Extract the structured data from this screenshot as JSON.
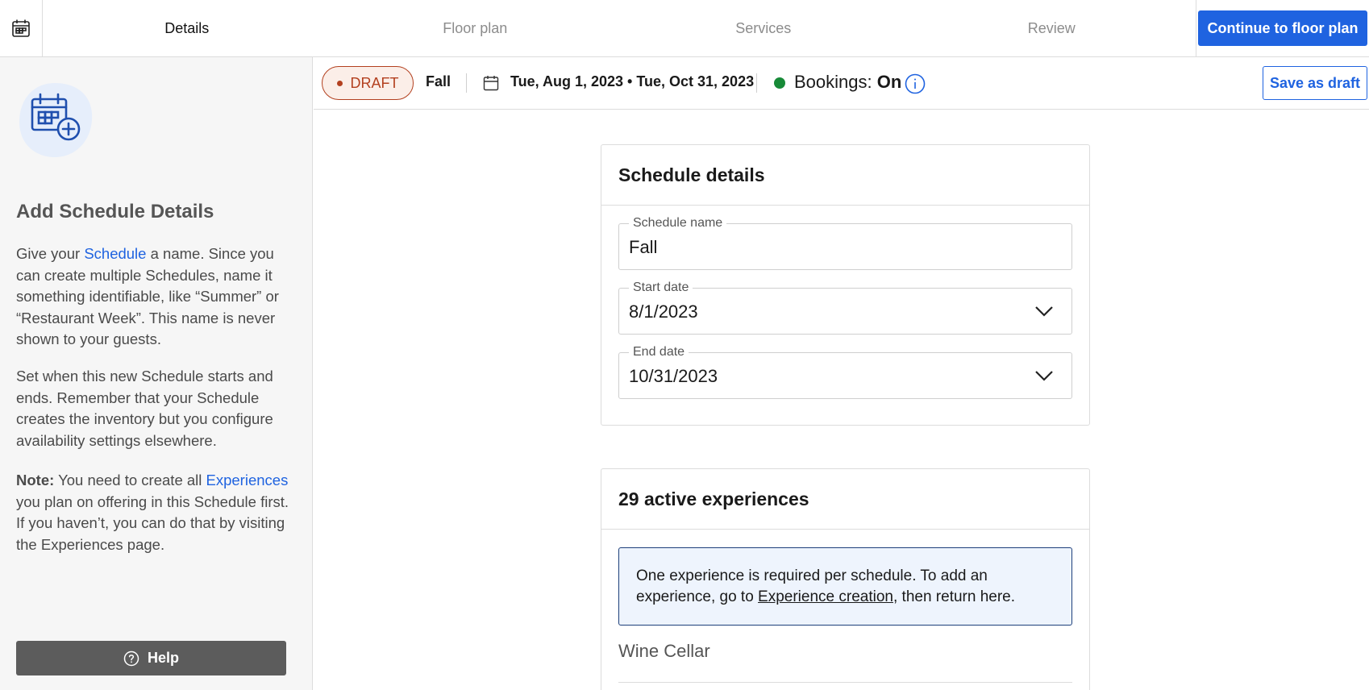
{
  "nav": {
    "steps": [
      {
        "label": "Details",
        "active": true
      },
      {
        "label": "Floor plan",
        "active": false
      },
      {
        "label": "Services",
        "active": false
      },
      {
        "label": "Review",
        "active": false
      }
    ],
    "continue_label": "Continue to floor plan"
  },
  "sidebar": {
    "title": "Add Schedule Details",
    "p1_pre": "Give your ",
    "p1_link": "Schedule",
    "p1_post": " a name. Since you can create multiple Schedules, name it something identifiable, like “Summer” or “Restaurant Week”. This name is never shown to your guests.",
    "p2": "Set when this new Schedule starts and ends. Remember that your Schedule creates the inventory but you configure availability settings elsewhere.",
    "p3_bold": "Note:",
    "p3_pre": " You need to create all ",
    "p3_link": "Experiences",
    "p3_post": " you plan on offering in this Schedule first. If you haven’t, you can do that by visiting the Experiences page.",
    "help_label": "Help"
  },
  "statusbar": {
    "badge": "DRAFT",
    "schedule_name": "Fall",
    "date_range": "Tue, Aug 1, 2023 • Tue, Oct 31, 2023",
    "bookings_label": "Bookings:",
    "bookings_value": "On",
    "save_draft_label": "Save as draft"
  },
  "details_card": {
    "title": "Schedule details",
    "name_label": "Schedule name",
    "name_value": "Fall",
    "start_label": "Start date",
    "start_value": "8/1/2023",
    "end_label": "End date",
    "end_value": "10/31/2023"
  },
  "experiences_card": {
    "title": "29 active experiences",
    "notice_pre": "One experience is required per schedule. To add an experience, go to ",
    "notice_link": "Experience creation",
    "notice_post": ", then return here.",
    "items": [
      "Wine Cellar"
    ]
  },
  "colors": {
    "primary": "#1f63e0",
    "draft": "#b3401f",
    "bookings_on": "#178a38"
  }
}
